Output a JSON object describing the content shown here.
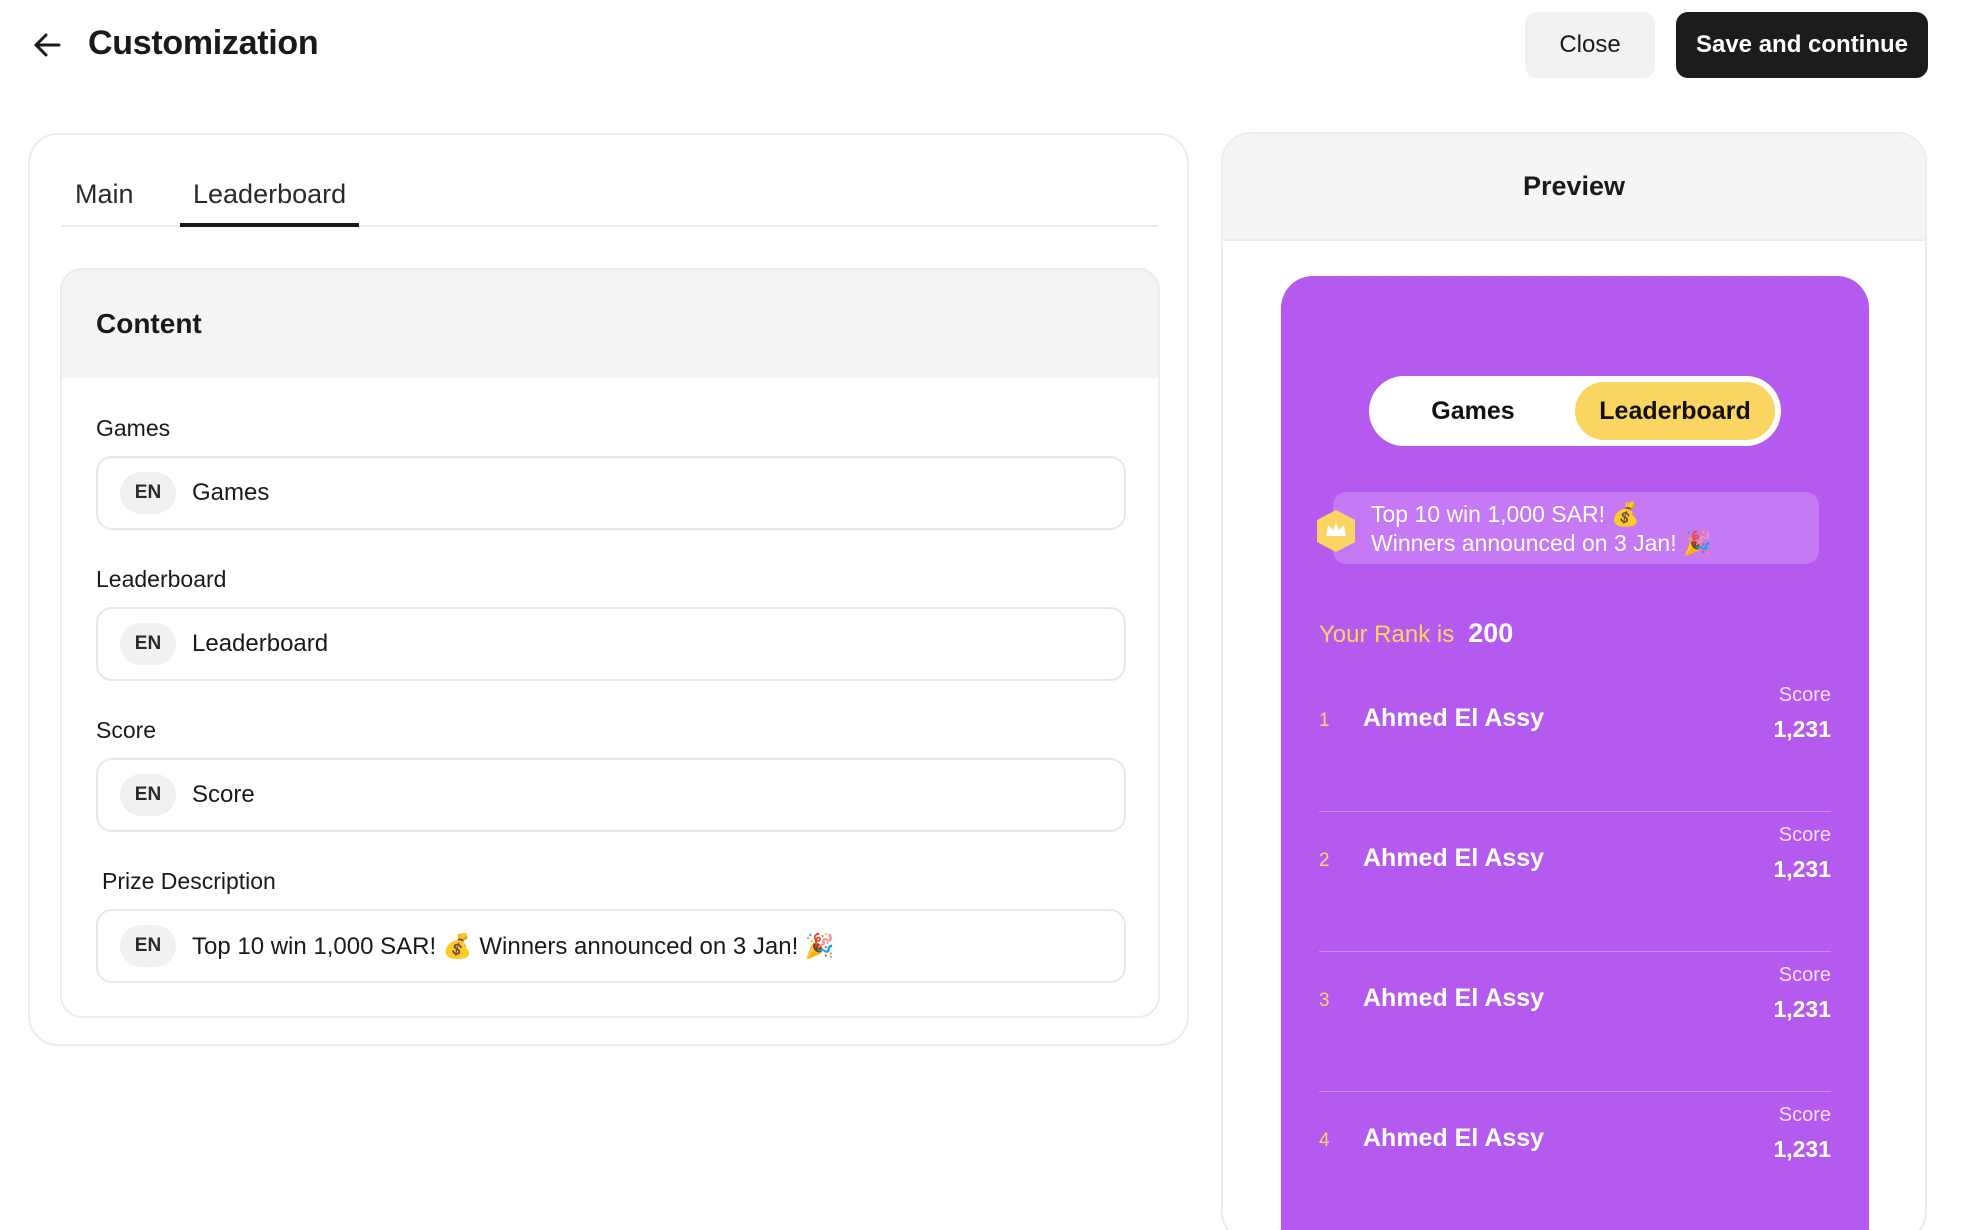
{
  "header": {
    "title": "Customization",
    "close_label": "Close",
    "save_label": "Save and continue"
  },
  "editor": {
    "tabs": [
      {
        "label": "Main",
        "active": false
      },
      {
        "label": "Leaderboard",
        "active": true
      }
    ],
    "section_title": "Content",
    "fields": [
      {
        "label": "Games",
        "lang": "EN",
        "value": "Games"
      },
      {
        "label": "Leaderboard",
        "lang": "EN",
        "value": "Leaderboard"
      },
      {
        "label": "Score",
        "lang": "EN",
        "value": "Score"
      },
      {
        "label": "Prize Description",
        "lang": "EN",
        "value": "Top 10 win 1,000 SAR! 💰 Winners announced on 3 Jan! 🎉"
      }
    ]
  },
  "preview": {
    "title": "Preview",
    "toggle": {
      "games_label": "Games",
      "leaderboard_label": "Leaderboard",
      "selected": "Leaderboard"
    },
    "prize": {
      "line1": "Top 10 win 1,000 SAR! 💰",
      "line2": "Winners announced on 3 Jan! 🎉"
    },
    "rank": {
      "label": "Your Rank is",
      "value": "200"
    },
    "rows": [
      {
        "position": "1",
        "name": "Ahmed El Assy",
        "score_label": "Score",
        "score": "1,231"
      },
      {
        "position": "2",
        "name": "Ahmed El Assy",
        "score_label": "Score",
        "score": "1,231"
      },
      {
        "position": "3",
        "name": "Ahmed El Assy",
        "score_label": "Score",
        "score": "1,231"
      },
      {
        "position": "4",
        "name": "Ahmed El Assy",
        "score_label": "Score",
        "score": "1,231"
      }
    ]
  },
  "colors": {
    "primary_dark": "#1c1c1e",
    "preview_purple": "#b45aef",
    "accent_yellow": "#fad562"
  }
}
